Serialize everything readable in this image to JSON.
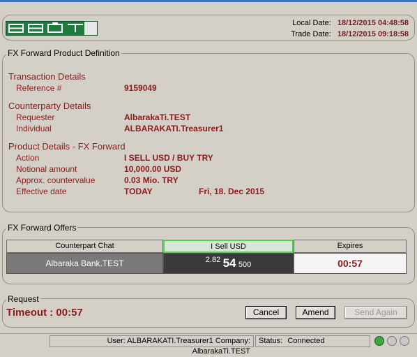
{
  "header": {
    "local_date_label": "Local Date:",
    "local_date_value": "18/12/2015 04:48:58",
    "trade_date_label": "Trade Date:",
    "trade_date_value": "18/12/2015 09:18:58"
  },
  "definition": {
    "title": "FX Forward Product Definition",
    "transaction_heading": "Transaction Details",
    "reference_label": "Reference #",
    "reference_value": "9159049",
    "counterparty_heading": "Counterparty Details",
    "requester_label": "Requester",
    "requester_value": "AlbarakaTi.TEST",
    "individual_label": "Individual",
    "individual_value": "ALBARAKATI.Treasurer1",
    "product_heading": "Product Details - FX Forward",
    "action_label": "Action",
    "action_value": "I SELL USD / BUY TRY",
    "notional_label": "Notional amount",
    "notional_value": "10,000.00 USD",
    "approx_label": "Approx. countervalue",
    "approx_value": "0.03 Mio. TRY",
    "effective_label": "Effective date",
    "effective_value": "TODAY",
    "effective_date": "Fri, 18. Dec 2015"
  },
  "offers": {
    "title": "FX Forward Offers",
    "col_counterpart": "Counterpart Chat",
    "col_sell": "I Sell USD",
    "col_expires": "Expires",
    "row_counterpart": "Albaraka Bank.TEST",
    "rate_small": "2.82",
    "rate_big": "54",
    "rate_tail": "500",
    "expires": "00:57"
  },
  "request": {
    "title": "Request",
    "timeout": "Timeout : 00:57",
    "cancel_label": "Cancel",
    "amend_label": "Amend",
    "send_again_label": "Send Again"
  },
  "statusbar": {
    "user_info": "User: ALBARAKATI.Treasurer1 Company: AlbarakaTi.TEST",
    "status_label": "Status:",
    "status_value": "Connected"
  },
  "colors": {
    "accent_red": "#8b1a1a",
    "logo_green": "#1f7a3e",
    "highlight_green": "#4cd44c"
  }
}
